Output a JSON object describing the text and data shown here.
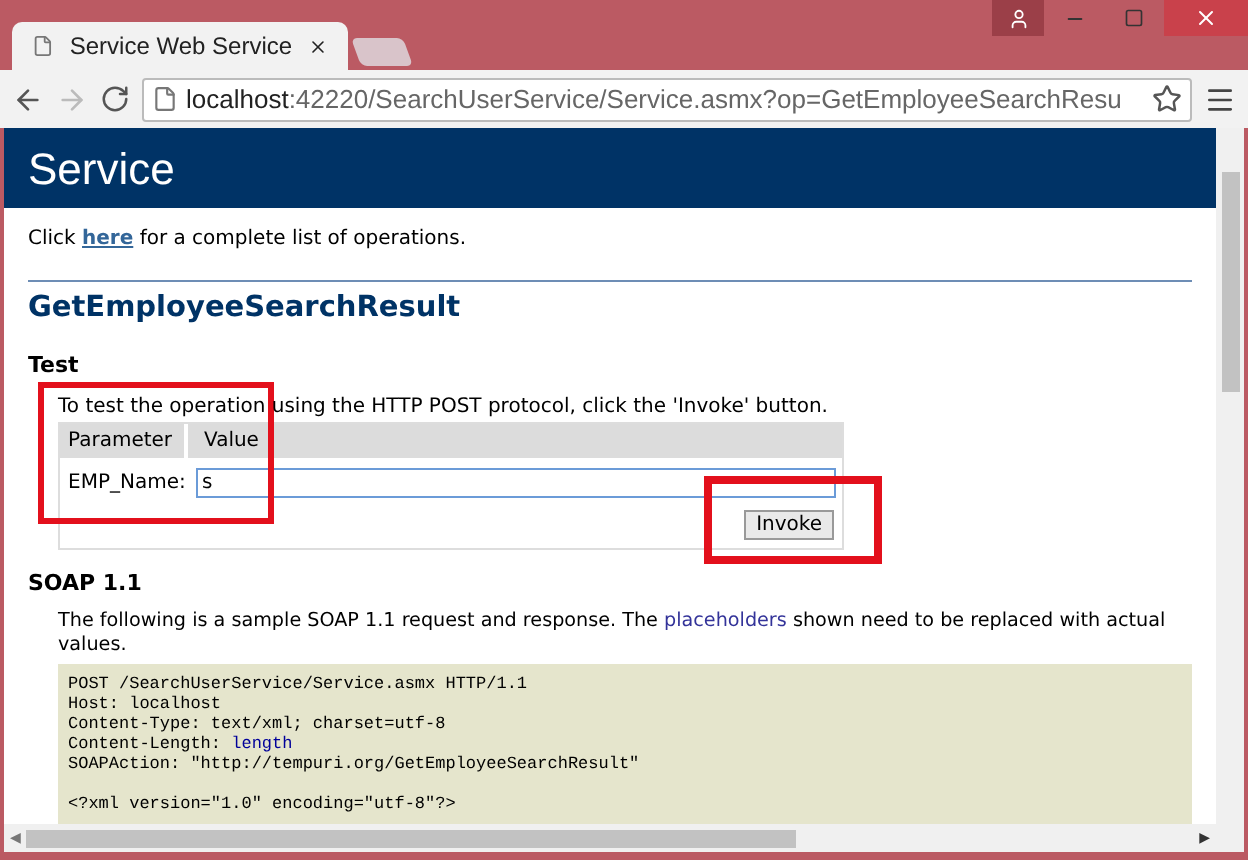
{
  "tab": {
    "title": "Service Web Service",
    "selected": true
  },
  "scroll_arrows": {
    "left": "◀",
    "right": "▶"
  },
  "address_bar": {
    "host": "localhost",
    "rest": ":42220/SearchUserService/Service.asmx?op=GetEmployeeSearchResu"
  },
  "page": {
    "banner": "Service",
    "intro": {
      "before": "Click ",
      "link": "here",
      "after": " for a complete list of operations."
    },
    "operation": "GetEmployeeSearchResult",
    "test": {
      "heading": "Test",
      "text": "To test the operation using the HTTP POST protocol, click the 'Invoke' button.",
      "columns": [
        "Parameter",
        "Value"
      ],
      "params": [
        {
          "name": "EMP_Name:",
          "value": "s"
        }
      ],
      "button": "Invoke"
    },
    "soap": {
      "heading": "SOAP 1.1",
      "before": "The following is a sample SOAP 1.1 request and response. The ",
      "link": "placeholders",
      "after": " shown need to be replaced with actual values.",
      "code_blocks": [
        [
          {
            "text": "POST /SearchUserService/Service.asmx HTTP/1.1"
          },
          {
            "text": "Host: localhost"
          },
          {
            "text": "Content-Type: text/xml; charset=utf-8"
          },
          {
            "text": "Content-Length: ",
            "placeholder": "length"
          },
          {
            "text": "SOAPAction: \"http://tempuri.org/GetEmployeeSearchResult\""
          }
        ],
        [
          {
            "text": "<?xml version=\"1.0\" encoding=\"utf-8\"?>"
          }
        ]
      ]
    }
  }
}
